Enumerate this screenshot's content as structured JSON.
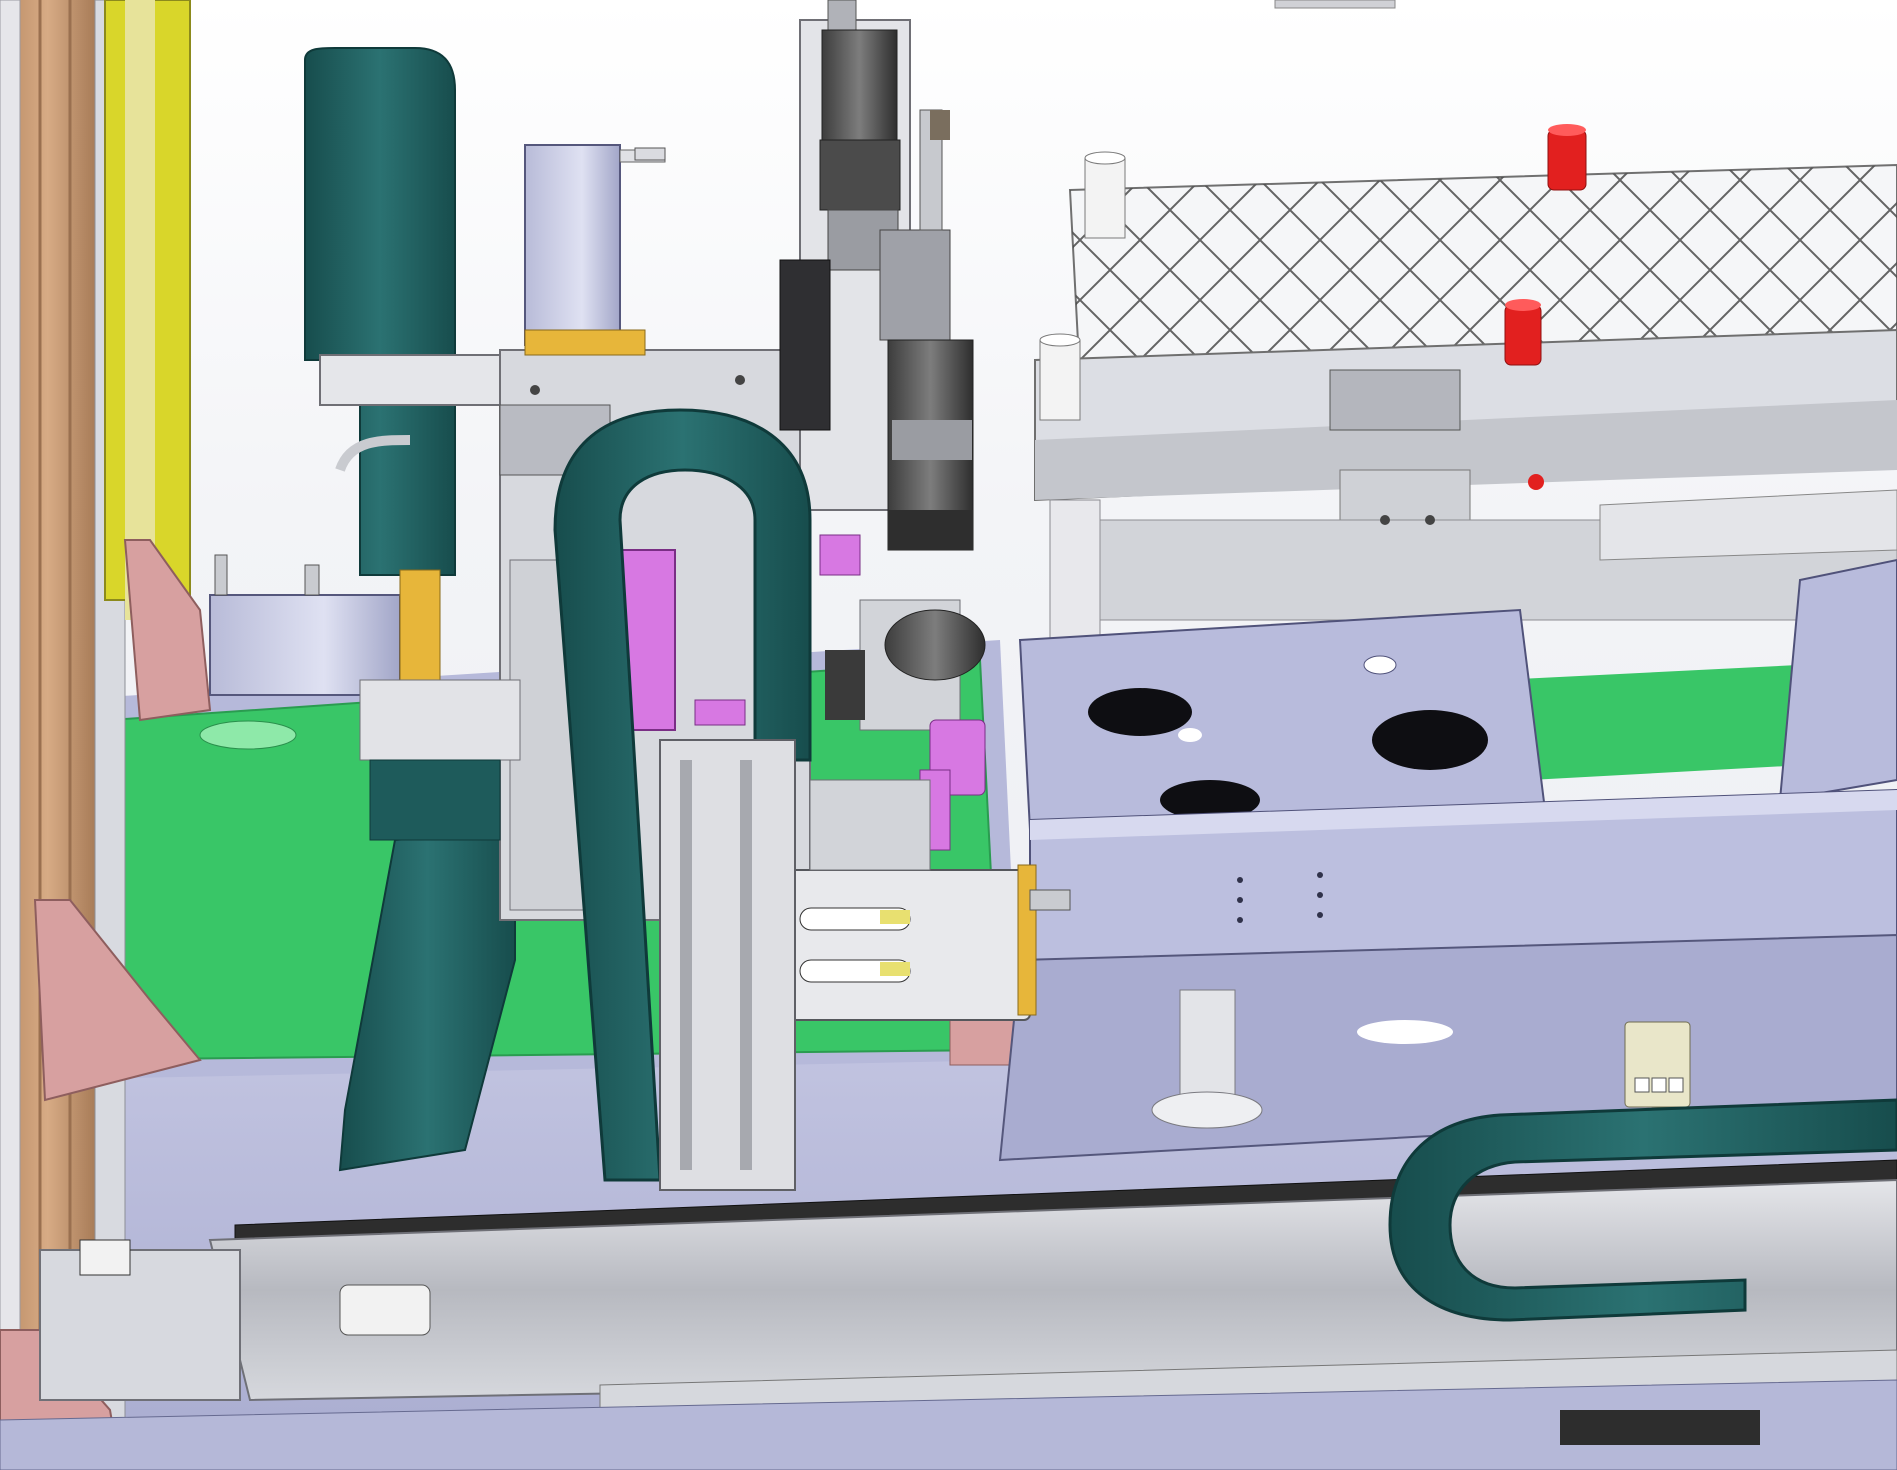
{
  "scene": {
    "type": "3d-cad-model",
    "colors": {
      "background": "#ffffff",
      "base_plate": "#b9bcdc",
      "green_panel": "#39c667",
      "cable_chain": "#1f5f5f",
      "frame_yellow": "#d9d62a",
      "frame_tan": "#c79a73",
      "bracket_pink": "#d7a0a0",
      "magenta_part": "#d778e2",
      "teal_part": "#18c5a6",
      "red_pin": "#e2201f",
      "gold_plate": "#e7b63a",
      "metal_gray": "#c8cad0",
      "dark_metal": "#3a3a3a",
      "black_rail": "#2d2d2d",
      "white_part": "#f3f3f3"
    }
  }
}
